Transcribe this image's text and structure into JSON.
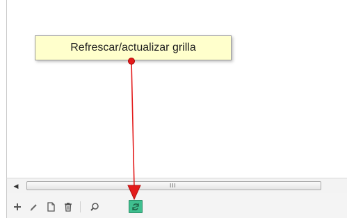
{
  "tooltip": {
    "text": "Refrescar/actualizar grilla"
  },
  "scrollbar": {
    "left_arrow": "◀",
    "grip": "III"
  },
  "toolbar": {
    "buttons": [
      {
        "name": "add-icon",
        "glyph": "+"
      },
      {
        "name": "edit-icon",
        "glyph": "pencil"
      },
      {
        "name": "view-icon",
        "glyph": "document"
      },
      {
        "name": "delete-icon",
        "glyph": "trash"
      },
      {
        "name": "search-icon",
        "glyph": "magnifier"
      },
      {
        "name": "refresh-icon",
        "glyph": "refresh"
      }
    ]
  },
  "colors": {
    "tooltip_bg": "#ffffcc",
    "arrow": "#e31b1b",
    "refresh_button": "#3fbf8f"
  }
}
